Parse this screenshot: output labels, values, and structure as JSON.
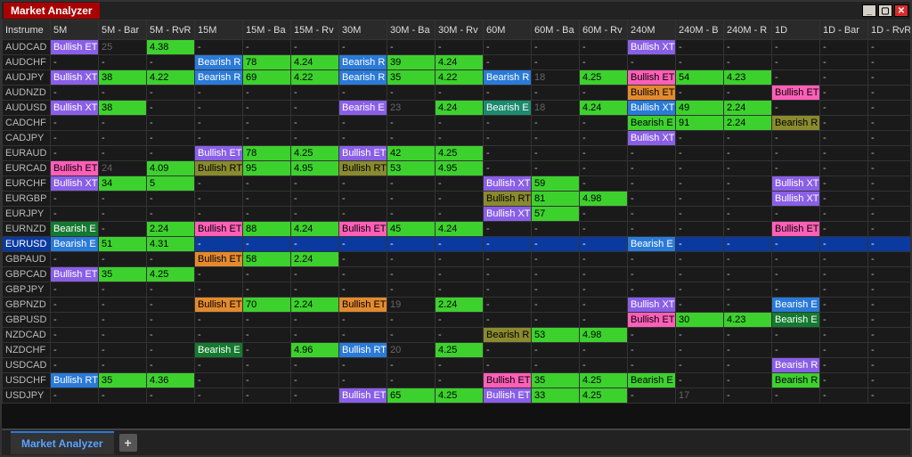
{
  "window": {
    "title": "Market Analyzer",
    "tab": "Market Analyzer"
  },
  "columns": [
    {
      "key": "instr",
      "label": "Instrume"
    },
    {
      "key": "5m",
      "label": "5M"
    },
    {
      "key": "5m_bar",
      "label": "5M - Bar"
    },
    {
      "key": "5m_rvr",
      "label": "5M - RvR"
    },
    {
      "key": "15m",
      "label": "15M"
    },
    {
      "key": "15m_bar",
      "label": "15M - Ba"
    },
    {
      "key": "15m_rvr",
      "label": "15M - Rv"
    },
    {
      "key": "30m",
      "label": "30M"
    },
    {
      "key": "30m_bar",
      "label": "30M - Ba"
    },
    {
      "key": "30m_rvr",
      "label": "30M - Rv"
    },
    {
      "key": "60m",
      "label": "60M"
    },
    {
      "key": "60m_bar",
      "label": "60M - Ba"
    },
    {
      "key": "60m_rvr",
      "label": "60M - Rv"
    },
    {
      "key": "240m",
      "label": "240M"
    },
    {
      "key": "240m_bar",
      "label": "240M - B"
    },
    {
      "key": "240m_rvr",
      "label": "240M - R"
    },
    {
      "key": "1d",
      "label": "1D"
    },
    {
      "key": "1d_bar",
      "label": "1D - Bar"
    },
    {
      "key": "1d_rvr",
      "label": "1D - RvR"
    }
  ],
  "rows": [
    {
      "instr": "AUDCAD",
      "cells": {
        "5m": {
          "t": "Bullish ET",
          "c": "violet"
        },
        "5m_bar": {
          "t": "25",
          "c": "",
          "dim": true
        },
        "5m_rvr": {
          "t": "4.38",
          "c": "green"
        },
        "240m": {
          "t": "Bullish XT",
          "c": "violet"
        }
      }
    },
    {
      "instr": "AUDCHF",
      "cells": {
        "15m": {
          "t": "Bearish R",
          "c": "blue"
        },
        "15m_bar": {
          "t": "78",
          "c": "green"
        },
        "15m_rvr": {
          "t": "4.24",
          "c": "green"
        },
        "30m": {
          "t": "Bearish R",
          "c": "blue"
        },
        "30m_bar": {
          "t": "39",
          "c": "green"
        },
        "30m_rvr": {
          "t": "4.24",
          "c": "green"
        }
      }
    },
    {
      "instr": "AUDJPY",
      "cells": {
        "5m": {
          "t": "Bullish XT",
          "c": "violet"
        },
        "5m_bar": {
          "t": "38",
          "c": "green"
        },
        "5m_rvr": {
          "t": "4.22",
          "c": "green"
        },
        "15m": {
          "t": "Bearish R",
          "c": "blue"
        },
        "15m_bar": {
          "t": "69",
          "c": "green"
        },
        "15m_rvr": {
          "t": "4.22",
          "c": "green"
        },
        "30m": {
          "t": "Bearish R",
          "c": "blue"
        },
        "30m_bar": {
          "t": "35",
          "c": "green"
        },
        "30m_rvr": {
          "t": "4.22",
          "c": "green"
        },
        "60m": {
          "t": "Bearish R",
          "c": "blue"
        },
        "60m_bar": {
          "t": "18",
          "c": "",
          "dim": true
        },
        "60m_rvr": {
          "t": "4.25",
          "c": "green"
        },
        "240m": {
          "t": "Bullish ET",
          "c": "pink"
        },
        "240m_bar": {
          "t": "54",
          "c": "green"
        },
        "240m_rvr": {
          "t": "4.23",
          "c": "green"
        }
      }
    },
    {
      "instr": "AUDNZD",
      "cells": {
        "240m": {
          "t": "Bullish ET",
          "c": "orange"
        },
        "1d": {
          "t": "Bullish ET",
          "c": "pink"
        }
      }
    },
    {
      "instr": "AUDUSD",
      "cells": {
        "5m": {
          "t": "Bullish XT",
          "c": "violet"
        },
        "5m_bar": {
          "t": "38",
          "c": "green"
        },
        "30m": {
          "t": "Bearish E",
          "c": "violet"
        },
        "30m_bar": {
          "t": "23",
          "c": "",
          "dim": true
        },
        "30m_rvr": {
          "t": "4.24",
          "c": "green"
        },
        "60m": {
          "t": "Bearish E",
          "c": "teal"
        },
        "60m_bar": {
          "t": "18",
          "c": "",
          "dim": true
        },
        "60m_rvr": {
          "t": "4.24",
          "c": "green"
        },
        "240m": {
          "t": "Bullish XT",
          "c": "blue"
        },
        "240m_bar": {
          "t": "49",
          "c": "green"
        },
        "240m_rvr": {
          "t": "2.24",
          "c": "green"
        }
      }
    },
    {
      "instr": "CADCHF",
      "cells": {
        "240m": {
          "t": "Bearish E",
          "c": "green"
        },
        "240m_bar": {
          "t": "91",
          "c": "green"
        },
        "240m_rvr": {
          "t": "2.24",
          "c": "green"
        },
        "1d": {
          "t": "Bearish R",
          "c": "olive"
        }
      }
    },
    {
      "instr": "CADJPY",
      "cells": {
        "240m": {
          "t": "Bullish XT",
          "c": "violet"
        }
      }
    },
    {
      "instr": "EURAUD",
      "cells": {
        "15m": {
          "t": "Bullish ET",
          "c": "violet"
        },
        "15m_bar": {
          "t": "78",
          "c": "green"
        },
        "15m_rvr": {
          "t": "4.25",
          "c": "green"
        },
        "30m": {
          "t": "Bullish ET",
          "c": "violet"
        },
        "30m_bar": {
          "t": "42",
          "c": "green"
        },
        "30m_rvr": {
          "t": "4.25",
          "c": "green"
        }
      }
    },
    {
      "instr": "EURCAD",
      "cells": {
        "5m": {
          "t": "Bullish ET",
          "c": "pink"
        },
        "5m_bar": {
          "t": "24",
          "c": "",
          "dim": true
        },
        "5m_rvr": {
          "t": "4.09",
          "c": "green"
        },
        "15m": {
          "t": "Bullish RT",
          "c": "olive"
        },
        "15m_bar": {
          "t": "95",
          "c": "green"
        },
        "15m_rvr": {
          "t": "4.95",
          "c": "green"
        },
        "30m": {
          "t": "Bullish RT",
          "c": "olive"
        },
        "30m_bar": {
          "t": "53",
          "c": "green"
        },
        "30m_rvr": {
          "t": "4.95",
          "c": "green"
        }
      }
    },
    {
      "instr": "EURCHF",
      "cells": {
        "5m": {
          "t": "Bullish XT",
          "c": "violet"
        },
        "5m_bar": {
          "t": "34",
          "c": "green"
        },
        "5m_rvr": {
          "t": "5",
          "c": "green"
        },
        "60m": {
          "t": "Bullish XT",
          "c": "violet"
        },
        "60m_bar": {
          "t": "59",
          "c": "green"
        },
        "1d": {
          "t": "Bullish XT",
          "c": "violet"
        }
      }
    },
    {
      "instr": "EURGBP",
      "cells": {
        "60m": {
          "t": "Bullish RT",
          "c": "olive"
        },
        "60m_bar": {
          "t": "81",
          "c": "green"
        },
        "60m_rvr": {
          "t": "4.98",
          "c": "green"
        },
        "1d": {
          "t": "Bullish XT",
          "c": "violet"
        }
      }
    },
    {
      "instr": "EURJPY",
      "cells": {
        "60m": {
          "t": "Bullish XT",
          "c": "violet"
        },
        "60m_bar": {
          "t": "57",
          "c": "green"
        }
      }
    },
    {
      "instr": "EURNZD",
      "cells": {
        "5m": {
          "t": "Bearish E",
          "c": "darkg"
        },
        "5m_rvr": {
          "t": "2.24",
          "c": "green"
        },
        "15m": {
          "t": "Bullish ET",
          "c": "pink"
        },
        "15m_bar": {
          "t": "88",
          "c": "green"
        },
        "15m_rvr": {
          "t": "4.24",
          "c": "green"
        },
        "30m": {
          "t": "Bullish ET",
          "c": "pink"
        },
        "30m_bar": {
          "t": "45",
          "c": "green"
        },
        "30m_rvr": {
          "t": "4.24",
          "c": "green"
        },
        "1d": {
          "t": "Bullish ET",
          "c": "pink"
        }
      }
    },
    {
      "instr": "EURUSD",
      "sel": true,
      "cells": {
        "5m": {
          "t": "Bearish E",
          "c": "blue"
        },
        "5m_bar": {
          "t": "51",
          "c": "green"
        },
        "5m_rvr": {
          "t": "4.31",
          "c": "green"
        },
        "240m": {
          "t": "Bearish E",
          "c": "blue"
        }
      }
    },
    {
      "instr": "GBPAUD",
      "cells": {
        "15m": {
          "t": "Bullish ET",
          "c": "orange"
        },
        "15m_bar": {
          "t": "58",
          "c": "green"
        },
        "15m_rvr": {
          "t": "2.24",
          "c": "green"
        }
      }
    },
    {
      "instr": "GBPCAD",
      "cells": {
        "5m": {
          "t": "Bullish ET",
          "c": "violet"
        },
        "5m_bar": {
          "t": "35",
          "c": "green"
        },
        "5m_rvr": {
          "t": "4.25",
          "c": "green"
        }
      }
    },
    {
      "instr": "GBPJPY",
      "cells": {}
    },
    {
      "instr": "GBPNZD",
      "cells": {
        "15m": {
          "t": "Bullish ET",
          "c": "orange"
        },
        "15m_bar": {
          "t": "70",
          "c": "green"
        },
        "15m_rvr": {
          "t": "2.24",
          "c": "green"
        },
        "30m": {
          "t": "Bullish ET",
          "c": "orange"
        },
        "30m_bar": {
          "t": "19",
          "c": "",
          "dim": true
        },
        "30m_rvr": {
          "t": "2.24",
          "c": "green"
        },
        "240m": {
          "t": "Bullish XT",
          "c": "violet"
        },
        "1d": {
          "t": "Bearish E",
          "c": "blue"
        }
      }
    },
    {
      "instr": "GBPUSD",
      "cells": {
        "240m": {
          "t": "Bullish ET",
          "c": "pink"
        },
        "240m_bar": {
          "t": "30",
          "c": "green"
        },
        "240m_rvr": {
          "t": "4.23",
          "c": "green"
        },
        "1d": {
          "t": "Bearish E",
          "c": "darkg"
        }
      }
    },
    {
      "instr": "NZDCAD",
      "cells": {
        "60m": {
          "t": "Bearish R",
          "c": "olive"
        },
        "60m_bar": {
          "t": "53",
          "c": "green"
        },
        "60m_rvr": {
          "t": "4.98",
          "c": "green"
        }
      }
    },
    {
      "instr": "NZDCHF",
      "cells": {
        "15m": {
          "t": "Bearish E",
          "c": "darkg"
        },
        "15m_rvr": {
          "t": "4.96",
          "c": "green"
        },
        "30m": {
          "t": "Bullish RT",
          "c": "blue"
        },
        "30m_bar": {
          "t": "20",
          "c": "",
          "dim": true
        },
        "30m_rvr": {
          "t": "4.25",
          "c": "green"
        }
      }
    },
    {
      "instr": "USDCAD",
      "cells": {
        "1d": {
          "t": "Bearish R",
          "c": "violet"
        }
      }
    },
    {
      "instr": "USDCHF",
      "cells": {
        "5m": {
          "t": "Bullish RT",
          "c": "blue"
        },
        "5m_bar": {
          "t": "35",
          "c": "green"
        },
        "5m_rvr": {
          "t": "4.36",
          "c": "green"
        },
        "60m": {
          "t": "Bullish ET",
          "c": "pink"
        },
        "60m_bar": {
          "t": "35",
          "c": "green"
        },
        "60m_rvr": {
          "t": "4.25",
          "c": "green"
        },
        "240m": {
          "t": "Bearish E",
          "c": "green"
        },
        "1d": {
          "t": "Bearish R",
          "c": "green"
        }
      }
    },
    {
      "instr": "USDJPY",
      "cells": {
        "30m": {
          "t": "Bullish ET",
          "c": "violet"
        },
        "30m_bar": {
          "t": "65",
          "c": "green"
        },
        "30m_rvr": {
          "t": "4.25",
          "c": "green"
        },
        "60m": {
          "t": "Bullish ET",
          "c": "violet"
        },
        "60m_bar": {
          "t": "33",
          "c": "green"
        },
        "60m_rvr": {
          "t": "4.25",
          "c": "green"
        },
        "240m_bar": {
          "t": "17",
          "c": "",
          "dim": true
        }
      }
    }
  ]
}
